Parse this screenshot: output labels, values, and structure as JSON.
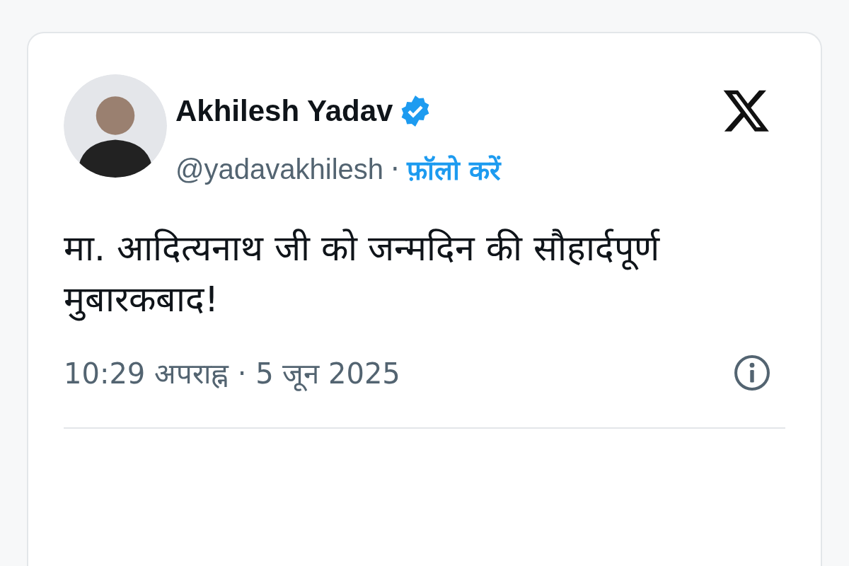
{
  "author": {
    "name": "Akhilesh Yadav",
    "verified": true,
    "handle": "@yadavakhilesh",
    "separator": "·",
    "follow_label": "फ़ॉलो करें"
  },
  "tweet": {
    "text": "मा. आदित्यनाथ जी को जन्मदिन की सौहार्दपूर्ण मुबारकबाद!",
    "timestamp": "10:29 अपराह्न · 5 जून 2025"
  }
}
